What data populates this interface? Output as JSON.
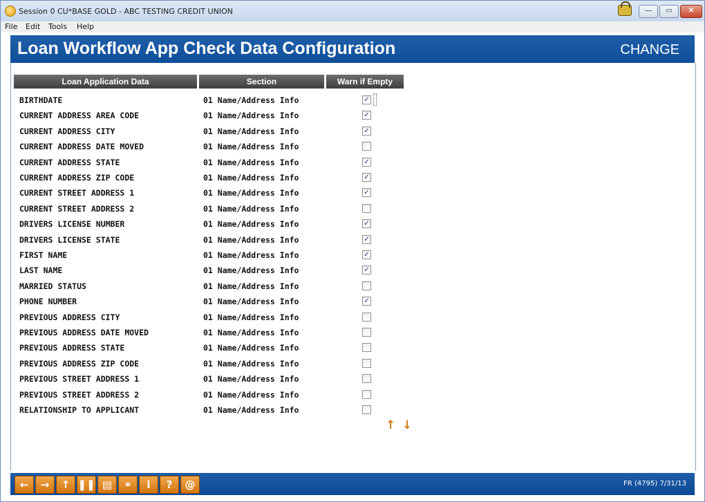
{
  "window": {
    "title": "Session 0 CU*BASE GOLD - ABC TESTING CREDIT UNION",
    "min_symbol": "—",
    "max_symbol": "▭",
    "close_symbol": "✕"
  },
  "menu": [
    "File",
    "Edit",
    "Tools",
    "Help"
  ],
  "header": {
    "title": "Loan Workflow App Check Data Configuration",
    "mode": "CHANGE"
  },
  "table": {
    "columns": [
      "Loan Application Data",
      "Section",
      "Warn if Empty"
    ],
    "rows": [
      {
        "field": "BIRTHDATE",
        "section": "01 Name/Address Info",
        "warn": "✓"
      },
      {
        "field": "CURRENT ADDRESS AREA CODE",
        "section": "01 Name/Address Info",
        "warn": "✓"
      },
      {
        "field": "CURRENT ADDRESS CITY",
        "section": "01 Name/Address Info",
        "warn": "✓"
      },
      {
        "field": "CURRENT ADDRESS DATE MOVED",
        "section": "01 Name/Address Info",
        "warn": ""
      },
      {
        "field": "CURRENT ADDRESS STATE",
        "section": "01 Name/Address Info",
        "warn": "✓"
      },
      {
        "field": "CURRENT ADDRESS ZIP CODE",
        "section": "01 Name/Address Info",
        "warn": "✓"
      },
      {
        "field": "CURRENT STREET ADDRESS 1",
        "section": "01 Name/Address Info",
        "warn": "✓"
      },
      {
        "field": "CURRENT STREET ADDRESS 2",
        "section": "01 Name/Address Info",
        "warn": ""
      },
      {
        "field": "DRIVERS LICENSE NUMBER",
        "section": "01 Name/Address Info",
        "warn": "✓"
      },
      {
        "field": "DRIVERS LICENSE STATE",
        "section": "01 Name/Address Info",
        "warn": "✓"
      },
      {
        "field": "FIRST NAME",
        "section": "01 Name/Address Info",
        "warn": "✓"
      },
      {
        "field": "LAST NAME",
        "section": "01 Name/Address Info",
        "warn": "✓"
      },
      {
        "field": "MARRIED STATUS",
        "section": "01 Name/Address Info",
        "warn": ""
      },
      {
        "field": "PHONE NUMBER",
        "section": "01 Name/Address Info",
        "warn": "✓"
      },
      {
        "field": "PREVIOUS ADDRESS CITY",
        "section": "01 Name/Address Info",
        "warn": ""
      },
      {
        "field": "PREVIOUS ADDRESS DATE MOVED",
        "section": "01 Name/Address Info",
        "warn": ""
      },
      {
        "field": "PREVIOUS ADDRESS STATE",
        "section": "01 Name/Address Info",
        "warn": ""
      },
      {
        "field": "PREVIOUS ADDRESS ZIP CODE",
        "section": "01 Name/Address Info",
        "warn": ""
      },
      {
        "field": "PREVIOUS STREET ADDRESS 1",
        "section": "01 Name/Address Info",
        "warn": ""
      },
      {
        "field": "PREVIOUS STREET ADDRESS 2",
        "section": "01 Name/Address Info",
        "warn": ""
      },
      {
        "field": "RELATIONSHIP TO APPLICANT",
        "section": "01 Name/Address Info",
        "warn": ""
      }
    ]
  },
  "scroll": {
    "up": "↑",
    "down": "↓"
  },
  "toolbar": {
    "buttons": [
      {
        "name": "back-arrow-icon",
        "glyph": "←"
      },
      {
        "name": "forward-arrow-icon",
        "glyph": "→"
      },
      {
        "name": "up-arrow-icon",
        "glyph": "↑"
      },
      {
        "name": "pause-icon",
        "glyph": "❚❚"
      },
      {
        "name": "print-icon",
        "glyph": "▤"
      },
      {
        "name": "link-icon",
        "glyph": "⚭"
      },
      {
        "name": "info-icon",
        "glyph": "i"
      },
      {
        "name": "help-icon",
        "glyph": "?"
      },
      {
        "name": "email-icon",
        "glyph": "@"
      }
    ],
    "screen_code": "FR (4795) 7/31/13"
  }
}
